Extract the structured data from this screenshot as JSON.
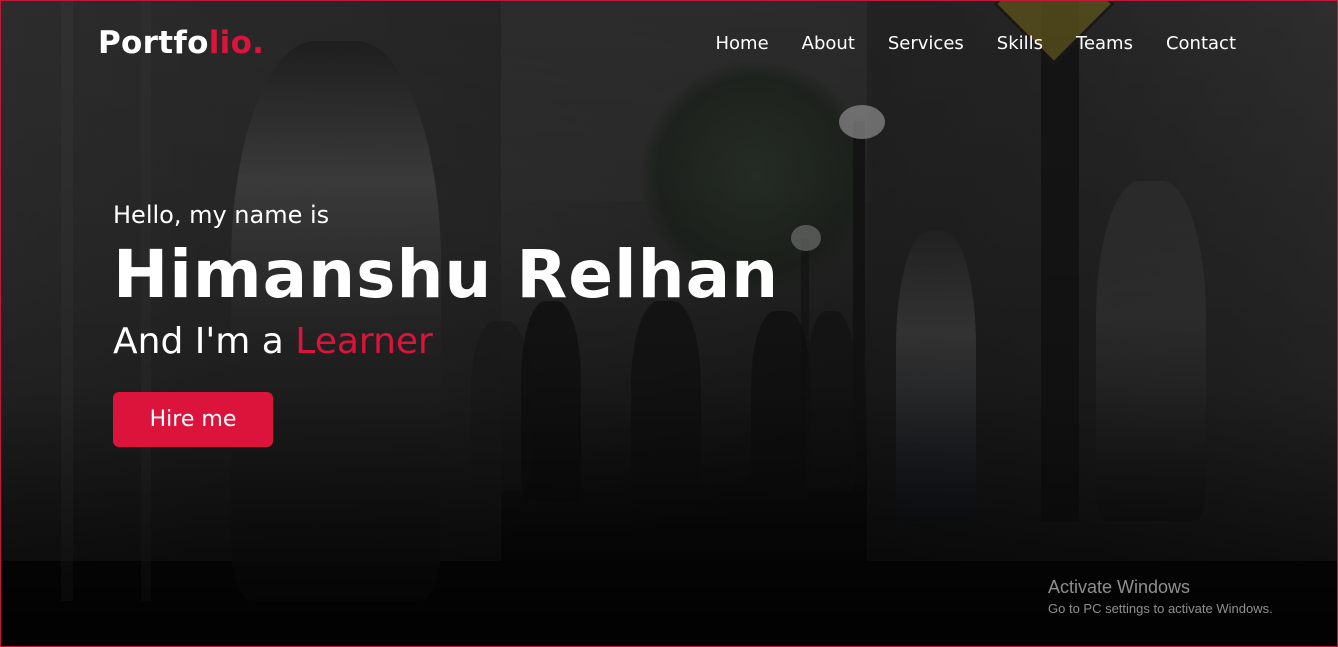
{
  "header": {
    "logo_main": "Portfo",
    "logo_accent": "lio.",
    "nav": [
      "Home",
      "About",
      "Services",
      "Skills",
      "Teams",
      "Contact"
    ]
  },
  "hero": {
    "greeting": "Hello, my name is",
    "name": "Himanshu Relhan",
    "role_prefix": "And I'm a ",
    "role_accent": "Learner",
    "cta_label": "Hire me"
  },
  "watermark": {
    "title": "Activate Windows",
    "subtitle": "Go to PC settings to activate Windows."
  },
  "colors": {
    "accent": "#dc143c",
    "text": "#ffffff"
  }
}
